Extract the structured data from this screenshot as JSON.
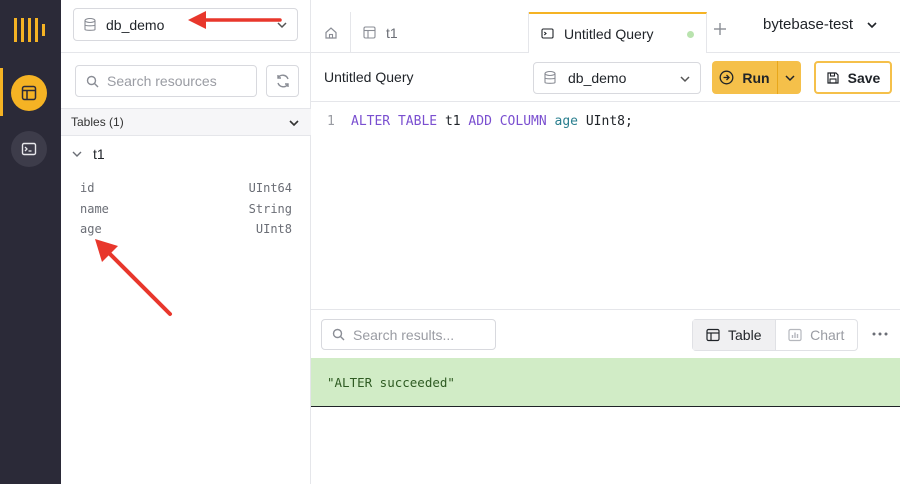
{
  "sidebar_rail": {
    "items": [
      {
        "icon": "table-icon",
        "active": true
      },
      {
        "icon": "terminal-icon",
        "active": false
      }
    ]
  },
  "left_panel": {
    "db_selector": {
      "value": "db_demo"
    },
    "search": {
      "placeholder": "Search resources"
    },
    "tables_header": "Tables (1)",
    "table": {
      "name": "t1",
      "columns": [
        {
          "name": "id",
          "type": "UInt64"
        },
        {
          "name": "name",
          "type": "String"
        },
        {
          "name": "age",
          "type": "UInt8"
        }
      ]
    }
  },
  "tabs": {
    "items": [
      {
        "label": "t1"
      },
      {
        "label": "Untitled Query"
      }
    ],
    "project": "bytebase-test"
  },
  "editor": {
    "title": "Untitled Query",
    "database": "db_demo",
    "run_label": "Run",
    "save_label": "Save",
    "line_number": "1",
    "code": {
      "alter": "ALTER",
      "table_kw": "TABLE",
      "table_name": "t1",
      "add": "ADD",
      "column_kw": "COLUMN",
      "column_name": "age",
      "type": "UInt8;"
    }
  },
  "results": {
    "search": {
      "placeholder": "Search results..."
    },
    "view_table": "Table",
    "view_chart": "Chart",
    "message": "\"ALTER succeeded\""
  },
  "colors": {
    "accent": "#f5b324",
    "rail": "#2b2a38",
    "success_bg": "#d1ecc6",
    "arrow": "#e8372c"
  }
}
